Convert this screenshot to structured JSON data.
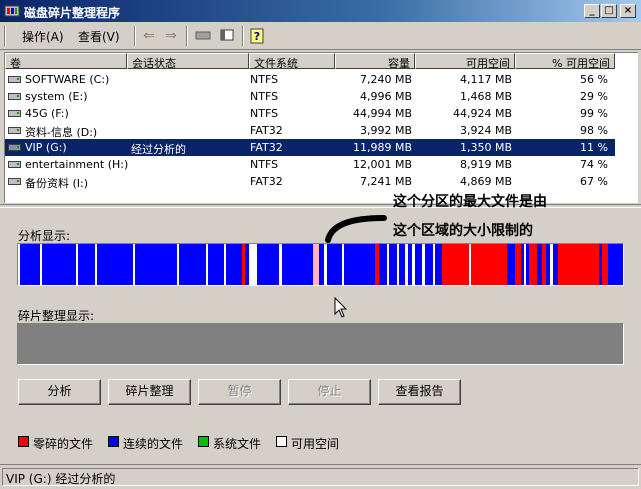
{
  "window": {
    "title": "磁盘碎片整理程序",
    "icon": "defrag-app-icon",
    "controls": {
      "minimize": "_",
      "maximize": "□",
      "close": "×"
    }
  },
  "menu": {
    "items": [
      "操作(A)",
      "查看(V)"
    ],
    "toolbar_icons": [
      "back-arrow-icon",
      "forward-arrow-icon",
      "drive-properties-icon",
      "view-icon",
      "help-icon"
    ]
  },
  "volume_list": {
    "columns": [
      "卷",
      "会话状态",
      "文件系统",
      "容量",
      "可用空间",
      "% 可用空间"
    ],
    "rows": [
      {
        "name": "SOFTWARE (C:)",
        "status": "",
        "fs": "NTFS",
        "capacity": "7,240 MB",
        "free": "4,117 MB",
        "pct": "56 %"
      },
      {
        "name": "system (E:)",
        "status": "",
        "fs": "NTFS",
        "capacity": "4,996 MB",
        "free": "1,468 MB",
        "pct": "29 %"
      },
      {
        "name": "45G (F:)",
        "status": "",
        "fs": "NTFS",
        "capacity": "44,994 MB",
        "free": "44,924 MB",
        "pct": "99 %"
      },
      {
        "name": "资料-信息 (D:)",
        "status": "",
        "fs": "FAT32",
        "capacity": "3,992 MB",
        "free": "3,924 MB",
        "pct": "98 %"
      },
      {
        "name": "VIP (G:)",
        "status": "经过分析的",
        "fs": "FAT32",
        "capacity": "11,989 MB",
        "free": "1,350 MB",
        "pct": "11 %"
      },
      {
        "name": "entertainment (H:)",
        "status": "",
        "fs": "NTFS",
        "capacity": "12,001 MB",
        "free": "8,919 MB",
        "pct": "74 %"
      },
      {
        "name": "备份资料 (I:)",
        "status": "",
        "fs": "FAT32",
        "capacity": "7,241 MB",
        "free": "4,869 MB",
        "pct": "67 %"
      }
    ],
    "selected_index": 4
  },
  "annotation": {
    "line1": "这个分区的最大文件是由",
    "line2": "这个区域的大小限制的"
  },
  "analysis": {
    "label": "分析显示:",
    "colors": {
      "fragmented": "#ff0000",
      "contiguous": "#0000ff",
      "system": "#00c000",
      "free": "#ffffff",
      "highlight": "#ffb6c1"
    },
    "segments": [
      {
        "start": 0.0,
        "end": 0.004,
        "kind": "free"
      },
      {
        "start": 0.036,
        "end": 0.039,
        "kind": "free"
      },
      {
        "start": 0.096,
        "end": 0.099,
        "kind": "free"
      },
      {
        "start": 0.128,
        "end": 0.131,
        "kind": "free"
      },
      {
        "start": 0.19,
        "end": 0.193,
        "kind": "free"
      },
      {
        "start": 0.262,
        "end": 0.266,
        "kind": "free"
      },
      {
        "start": 0.31,
        "end": 0.314,
        "kind": "free"
      },
      {
        "start": 0.34,
        "end": 0.344,
        "kind": "free"
      },
      {
        "start": 0.37,
        "end": 0.375,
        "kind": "fragmented"
      },
      {
        "start": 0.382,
        "end": 0.395,
        "kind": "free"
      },
      {
        "start": 0.432,
        "end": 0.436,
        "kind": "free"
      },
      {
        "start": 0.488,
        "end": 0.498,
        "kind": "highlight"
      },
      {
        "start": 0.505,
        "end": 0.51,
        "kind": "free"
      },
      {
        "start": 0.536,
        "end": 0.539,
        "kind": "free"
      },
      {
        "start": 0.59,
        "end": 0.596,
        "kind": "fragmented"
      },
      {
        "start": 0.61,
        "end": 0.614,
        "kind": "free"
      },
      {
        "start": 0.626,
        "end": 0.63,
        "kind": "free"
      },
      {
        "start": 0.64,
        "end": 0.644,
        "kind": "free"
      },
      {
        "start": 0.652,
        "end": 0.656,
        "kind": "free"
      },
      {
        "start": 0.668,
        "end": 0.672,
        "kind": "free"
      },
      {
        "start": 0.686,
        "end": 0.69,
        "kind": "free"
      },
      {
        "start": 0.7,
        "end": 0.808,
        "kind": "fragmented"
      },
      {
        "start": 0.745,
        "end": 0.749,
        "kind": "free"
      },
      {
        "start": 0.808,
        "end": 0.822,
        "kind": "contiguous"
      },
      {
        "start": 0.822,
        "end": 0.832,
        "kind": "fragmented"
      },
      {
        "start": 0.836,
        "end": 0.84,
        "kind": "free"
      },
      {
        "start": 0.845,
        "end": 0.858,
        "kind": "fragmented"
      },
      {
        "start": 0.866,
        "end": 0.872,
        "kind": "fragmented"
      },
      {
        "start": 0.88,
        "end": 0.884,
        "kind": "free"
      },
      {
        "start": 0.892,
        "end": 0.96,
        "kind": "fragmented"
      },
      {
        "start": 0.966,
        "end": 0.976,
        "kind": "fragmented"
      }
    ]
  },
  "defrag": {
    "label": "碎片整理显示:"
  },
  "buttons": [
    {
      "label": "分析",
      "enabled": true
    },
    {
      "label": "碎片整理",
      "enabled": true
    },
    {
      "label": "暂停",
      "enabled": false
    },
    {
      "label": "停止",
      "enabled": false
    },
    {
      "label": "查看报告",
      "enabled": true
    }
  ],
  "legend": [
    {
      "label": "零碎的文件",
      "color": "#ff0000"
    },
    {
      "label": "连续的文件",
      "color": "#0000ff"
    },
    {
      "label": "系统文件",
      "color": "#00c000"
    },
    {
      "label": "可用空间",
      "color": "#ffffff"
    }
  ],
  "statusbar": {
    "text": "VIP (G:) 经过分析的"
  }
}
